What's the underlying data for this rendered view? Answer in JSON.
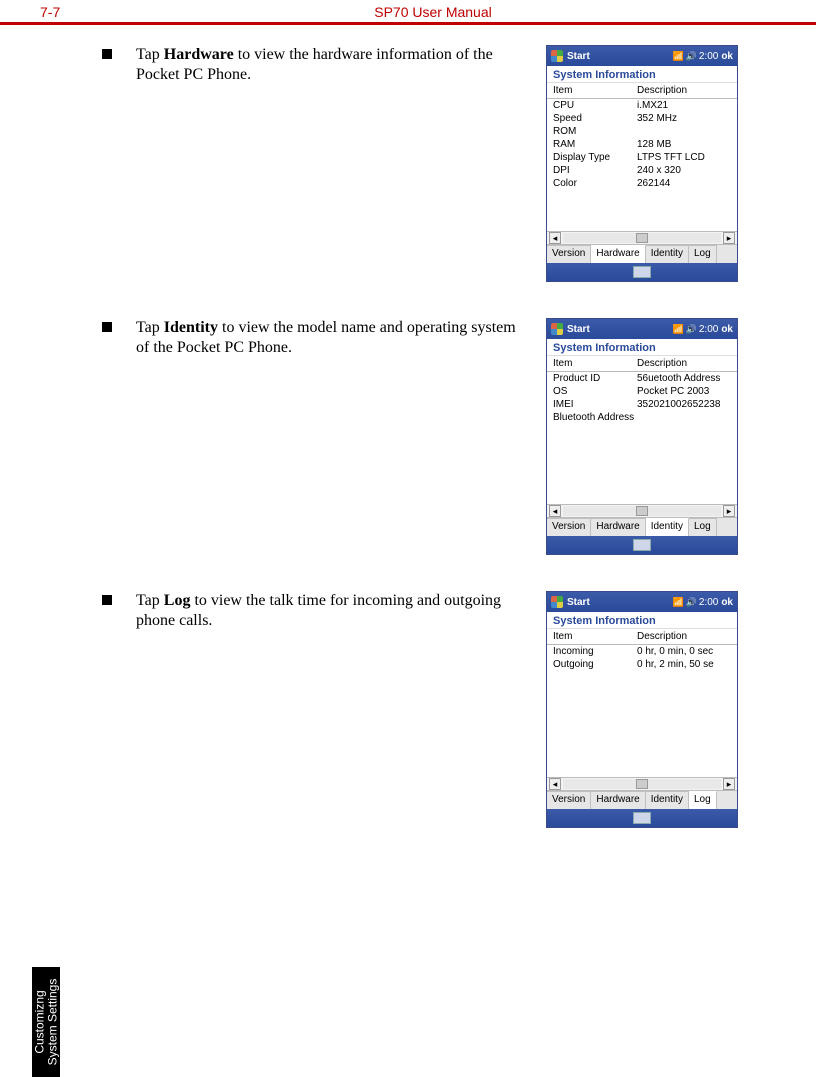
{
  "page_number": "7-7",
  "manual_title": "SP70 User Manual",
  "side_tab_line1": "Customizng",
  "side_tab_line2": "System Settings",
  "bullets": {
    "b1_pre": "Tap ",
    "b1_bold": "Hardware",
    "b1_post": " to view the hardware information of the Pocket PC Phone.",
    "b2_pre": "Tap ",
    "b2_bold": "Identity",
    "b2_post": " to view the model name and operating system of the Pocket PC Phone.",
    "b3_pre": "Tap ",
    "b3_bold": "Log",
    "b3_post": " to view the talk time for incoming and outgoing phone calls."
  },
  "device": {
    "start_label": "Start",
    "time": "2:00",
    "ok": "ok",
    "app_title": "System Information",
    "col_item": "Item",
    "col_desc": "Description",
    "tabs": {
      "version": "Version",
      "hardware": "Hardware",
      "identity": "Identity",
      "log": "Log"
    }
  },
  "shot1_rows": [
    {
      "item": "CPU",
      "desc": "i.MX21"
    },
    {
      "item": "Speed",
      "desc": "352 MHz"
    },
    {
      "item": "ROM",
      "desc": ""
    },
    {
      "item": "RAM",
      "desc": "128 MB"
    },
    {
      "item": "Display Type",
      "desc": "LTPS TFT LCD"
    },
    {
      "item": "DPI",
      "desc": "240 x 320"
    },
    {
      "item": "Color",
      "desc": "262144"
    }
  ],
  "shot2_rows": [
    {
      "item": "Product ID",
      "desc": "56uetooth Address"
    },
    {
      "item": "OS",
      "desc": "Pocket PC 2003"
    },
    {
      "item": "IMEI",
      "desc": "352021002652238"
    },
    {
      "item": "Bluetooth Address",
      "desc": ""
    }
  ],
  "shot3_rows": [
    {
      "item": "Incoming",
      "desc": "0 hr, 0 min, 0 sec"
    },
    {
      "item": "Outgoing",
      "desc": "0 hr, 2 min, 50 se"
    }
  ]
}
